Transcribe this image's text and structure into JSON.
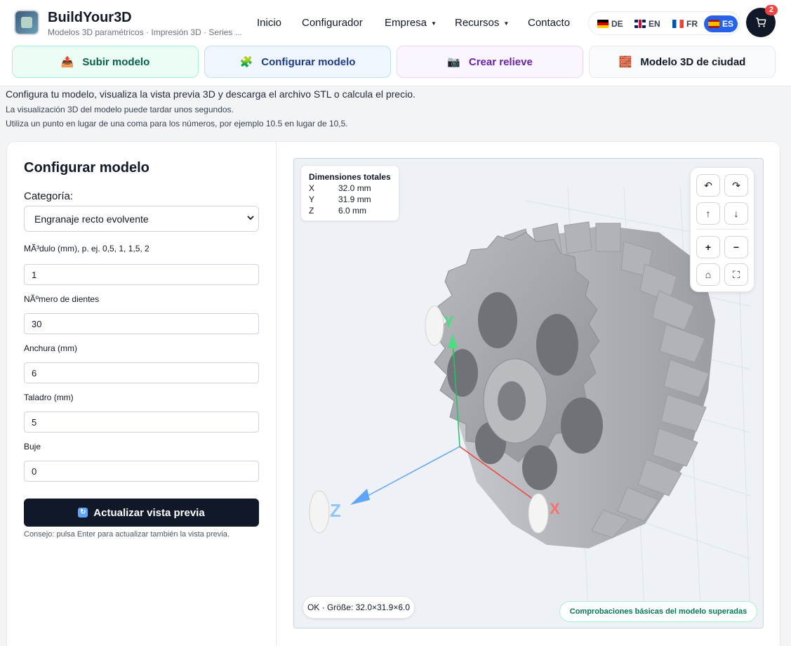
{
  "brand": {
    "title": "BuildYour3D",
    "subtitle": "Modelos 3D paramétricos · Impresión 3D · Series ..."
  },
  "nav": [
    {
      "label": "Inicio"
    },
    {
      "label": "Configurador"
    },
    {
      "label": "Empresa"
    },
    {
      "label": "Recursos"
    },
    {
      "label": "Contacto"
    }
  ],
  "languages": [
    {
      "code": "DE",
      "flag": "flag-de-icon"
    },
    {
      "code": "EN",
      "flag": "flag-en-icon"
    },
    {
      "code": "FR",
      "flag": "flag-fr-icon"
    },
    {
      "code": "ES",
      "flag": "flag-es-icon",
      "active": true
    }
  ],
  "cart": {
    "count": "2",
    "icon": "cart-icon"
  },
  "tabs": [
    {
      "label": "Subir modelo",
      "icon": "upload-box-icon"
    },
    {
      "label": "Configurar modelo",
      "icon": "puzzle-icon"
    },
    {
      "label": "Crear relieve",
      "icon": "camera-icon"
    },
    {
      "label": "Modelo 3D de ciudad",
      "icon": "brick-icon"
    }
  ],
  "intro": {
    "text": "Configura tu modelo, visualiza la vista previa 3D y descarga el archivo STL o calcula el precio.",
    "note1": "La visualización 3D del modelo puede tardar unos segundos.",
    "note2": "Utiliza un punto en lugar de una coma para los números, por ejemplo 10.5 en lugar de 10,5."
  },
  "form": {
    "title": "Configurar modelo",
    "category_label": "Categoría:",
    "category_value": "Engranaje recto evolvente",
    "fields": [
      {
        "label": "MÃ³dulo (mm), p. ej. 0,5, 1, 1,5, 2",
        "value": "1"
      },
      {
        "label": "NÃºmero de dientes",
        "value": "30"
      },
      {
        "label": "Anchura (mm)",
        "value": "6"
      },
      {
        "label": "Taladro (mm)",
        "value": "5"
      },
      {
        "label": "Buje",
        "value": "0"
      }
    ],
    "update_label": "Actualizar vista previa",
    "hint": "Consejo: pulsa Enter para actualizar también la vista previa."
  },
  "viewer": {
    "dims_title": "Dimensiones totales",
    "dims": [
      {
        "axis": "X",
        "value": "32.0 mm"
      },
      {
        "axis": "Y",
        "value": "31.9 mm"
      },
      {
        "axis": "Z",
        "value": "6.0 mm"
      }
    ],
    "axis_labels": {
      "x": "X",
      "y": "Y",
      "z": "Z"
    },
    "status": "OK · Größe: 32.0×31.9×6.0",
    "checks": "Comprobaciones básicas del modelo superadas",
    "controls": [
      "rotate-left-icon",
      "rotate-right-icon",
      "arrow-up-icon",
      "arrow-down-icon",
      "zoom-in-icon",
      "zoom-out-icon",
      "home-icon",
      "fullscreen-icon"
    ]
  },
  "colors": {
    "accent": "#2563eb",
    "dark": "#111827",
    "gear": "#a3a6ab"
  }
}
